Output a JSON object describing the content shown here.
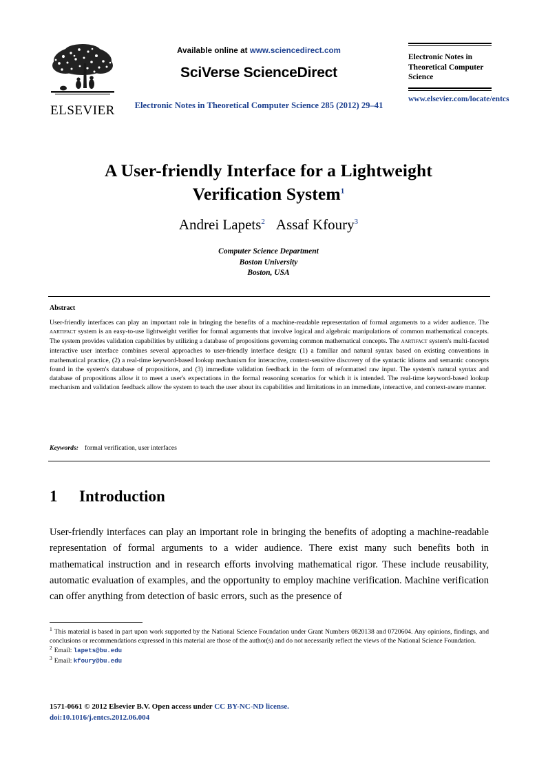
{
  "colors": {
    "link_blue": "#1b3f8f",
    "text_black": "#000000",
    "page_background": "#ffffff"
  },
  "header": {
    "publisher_logo_name": "ELSEVIER",
    "available_prefix": "Available online at",
    "sciencedirect_url": "www.sciencedirect.com",
    "platform_brand": "SciVerse ScienceDirect",
    "journal_reference": "Electronic Notes in Theoretical Computer Science 285 (2012) 29–41",
    "journal_title": "Electronic Notes in Theoretical Computer Science",
    "journal_url": "www.elsevier.com/locate/entcs"
  },
  "article": {
    "title_line1": "A User-friendly Interface for a Lightweight",
    "title_line2": "Verification System",
    "title_footnote_marker": "1",
    "authors": [
      {
        "name": "Andrei Lapets",
        "marker": "2"
      },
      {
        "name": "Assaf Kfoury",
        "marker": "3"
      }
    ],
    "affiliation_lines": [
      "Computer Science Department",
      "Boston University",
      "Boston, USA"
    ]
  },
  "abstract": {
    "heading": "Abstract",
    "text_part1": "User-friendly interfaces can play an important role in bringing the benefits of a machine-readable representation of formal arguments to a wider audience. The ",
    "system_name_1": "aartifact",
    "text_part2": " system is an easy-to-use lightweight verifier for formal arguments that involve logical and algebraic manipulations of common mathematical concepts. The system provides validation capabilities by utilizing a database of propositions governing common mathematical concepts. The ",
    "system_name_2": "aartifact",
    "text_part3": " system's multi-faceted interactive user interface combines several approaches to user-friendly interface design: (1) a familiar and natural syntax based on existing conventions in mathematical practice, (2) a real-time keyword-based lookup mechanism for interactive, context-sensitive discovery of the syntactic idioms and semantic concepts found in the system's database of propositions, and (3) immediate validation feedback in the form of reformatted raw input. The system's natural syntax and database of propositions allow it to meet a user's expectations in the formal reasoning scenarios for which it is intended. The real-time keyword-based lookup mechanism and validation feedback allow the system to teach the user about its capabilities and limitations in an immediate, interactive, and context-aware manner."
  },
  "keywords": {
    "label": "Keywords:",
    "value": "formal verification, user interfaces"
  },
  "section": {
    "number": "1",
    "title": "Introduction",
    "paragraph": "User-friendly interfaces can play an important role in bringing the benefits of adopting a machine-readable representation of formal arguments to a wider audience. There exist many such benefits both in mathematical instruction and in research efforts involving mathematical rigor. These include reusability, automatic evaluation of examples, and the opportunity to employ machine verification. Machine verification can offer anything from detection of basic errors, such as the presence of"
  },
  "footnotes": [
    {
      "marker": "1",
      "text": "This material is based in part upon work supported by the National Science Foundation under Grant Numbers 0820138 and 0720604. Any opinions, findings, and conclusions or recommendations expressed in this material are those of the author(s) and do not necessarily reflect the views of the National Science Foundation."
    },
    {
      "marker": "2",
      "label": "Email:",
      "email": "lapets@bu.edu"
    },
    {
      "marker": "3",
      "label": "Email:",
      "email": "kfoury@bu.edu"
    }
  ],
  "copyright": {
    "issn_and_notice": "1571-0661 © 2012 Elsevier B.V. Open access under ",
    "license": "CC BY-NC-ND license.",
    "doi": "doi:10.1016/j.entcs.2012.06.004"
  }
}
